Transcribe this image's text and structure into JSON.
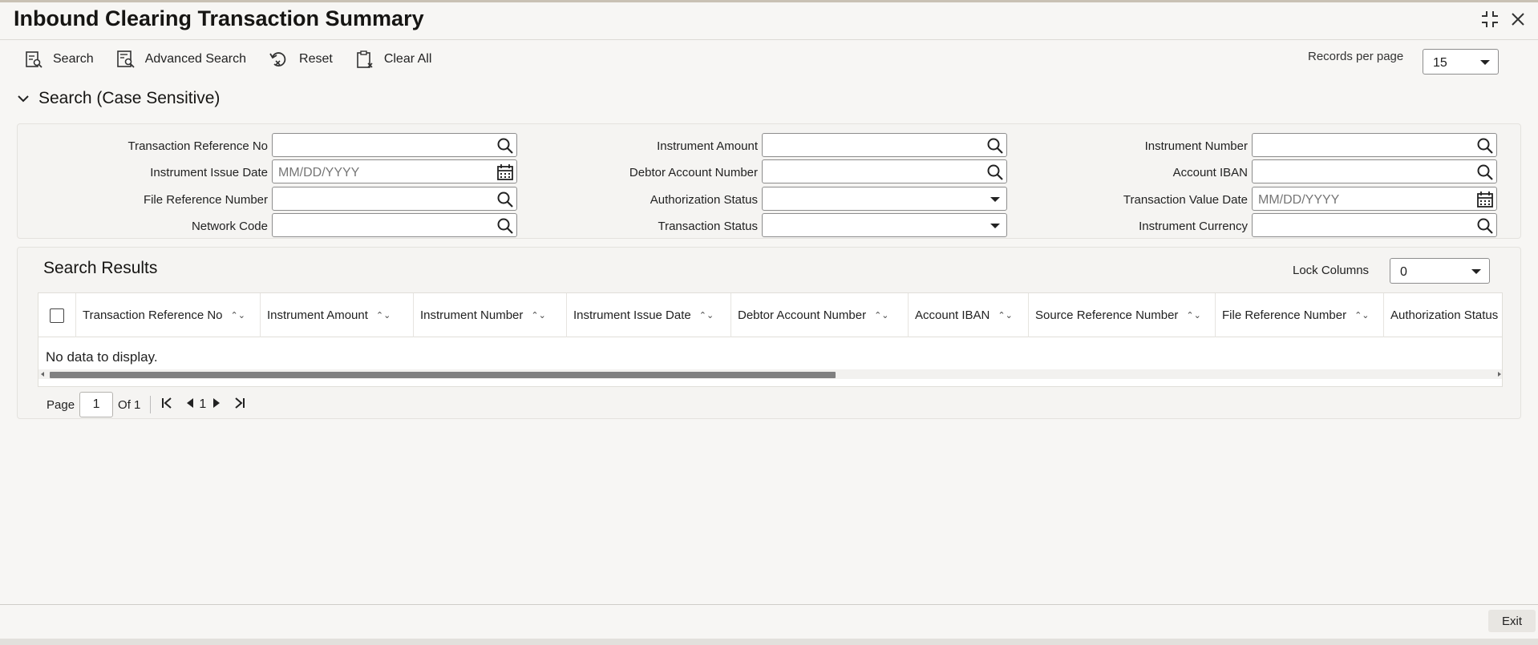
{
  "window": {
    "title": "Inbound Clearing Transaction Summary"
  },
  "toolbar": {
    "search_label": "Search",
    "advanced_search_label": "Advanced Search",
    "reset_label": "Reset",
    "clear_all_label": "Clear All"
  },
  "records_per_page": {
    "label": "Records per page",
    "value": "15"
  },
  "search_section": {
    "title": "Search (Case Sensitive)",
    "fields": {
      "txn_ref_no": {
        "label": "Transaction Reference No",
        "value": ""
      },
      "instrument_issue_date": {
        "label": "Instrument Issue Date",
        "placeholder": "MM/DD/YYYY"
      },
      "file_ref_number": {
        "label": "File Reference Number",
        "value": ""
      },
      "network_code": {
        "label": "Network Code",
        "value": ""
      },
      "instrument_amount": {
        "label": "Instrument Amount",
        "value": ""
      },
      "debtor_account_number": {
        "label": "Debtor Account Number",
        "value": ""
      },
      "authorization_status": {
        "label": "Authorization Status",
        "value": ""
      },
      "transaction_status": {
        "label": "Transaction Status",
        "value": ""
      },
      "instrument_number": {
        "label": "Instrument Number",
        "value": ""
      },
      "account_iban": {
        "label": "Account IBAN",
        "value": ""
      },
      "transaction_value_date": {
        "label": "Transaction Value Date",
        "placeholder": "MM/DD/YYYY"
      },
      "instrument_currency": {
        "label": "Instrument Currency",
        "value": ""
      }
    }
  },
  "results": {
    "title": "Search Results",
    "lock_columns_label": "Lock Columns",
    "lock_columns_value": "0",
    "columns": [
      "Transaction Reference No",
      "Instrument Amount",
      "Instrument Number",
      "Instrument Issue Date",
      "Debtor Account Number",
      "Account IBAN",
      "Source Reference Number",
      "File Reference Number",
      "Authorization Status"
    ],
    "empty_message": "No data to display."
  },
  "pager": {
    "page_label": "Page",
    "current_page": "1",
    "of_label": "Of 1",
    "page_link": "1"
  },
  "footer": {
    "exit_label": "Exit"
  }
}
